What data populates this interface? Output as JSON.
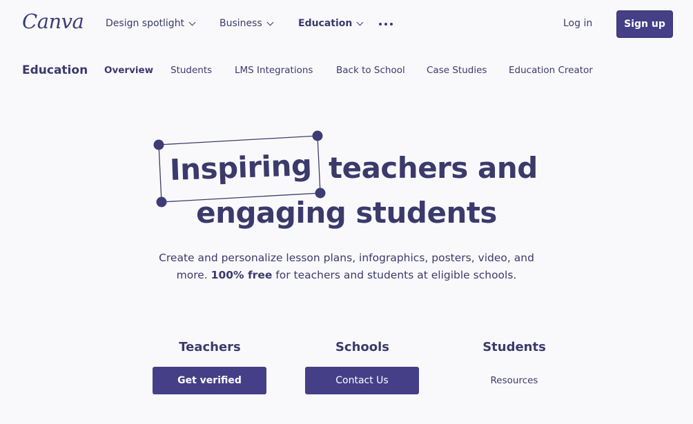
{
  "header": {
    "logo": "Canva",
    "nav": [
      {
        "label": "Design spotlight"
      },
      {
        "label": "Business"
      },
      {
        "label": "Education"
      }
    ],
    "more_icon": "more-horizontal-icon",
    "login": "Log in",
    "signup": "Sign up"
  },
  "subnav": {
    "title": "Education",
    "links": [
      "Overview",
      "Students",
      "LMS Integrations",
      "Back to School",
      "Case Studies",
      "Education Creator"
    ],
    "active": "Overview"
  },
  "hero": {
    "highlight_word": "Inspiring",
    "line1_rest": "teachers and",
    "line2": "engaging students",
    "sub_a": "Create and personalize lesson plans, infographics, posters, video, and",
    "sub_b_pre": "more. ",
    "sub_b_bold": "100% free",
    "sub_b_post": " for teachers and students at eligible schools."
  },
  "audiences": [
    {
      "title": "Teachers",
      "cta": "Get verified"
    },
    {
      "title": "Schools",
      "cta": "Contact Us"
    },
    {
      "title": "Students",
      "cta": "Resources"
    }
  ],
  "colors": {
    "brand": "#443f87",
    "text": "#3b3a6b",
    "background": "#f9f9fc"
  }
}
